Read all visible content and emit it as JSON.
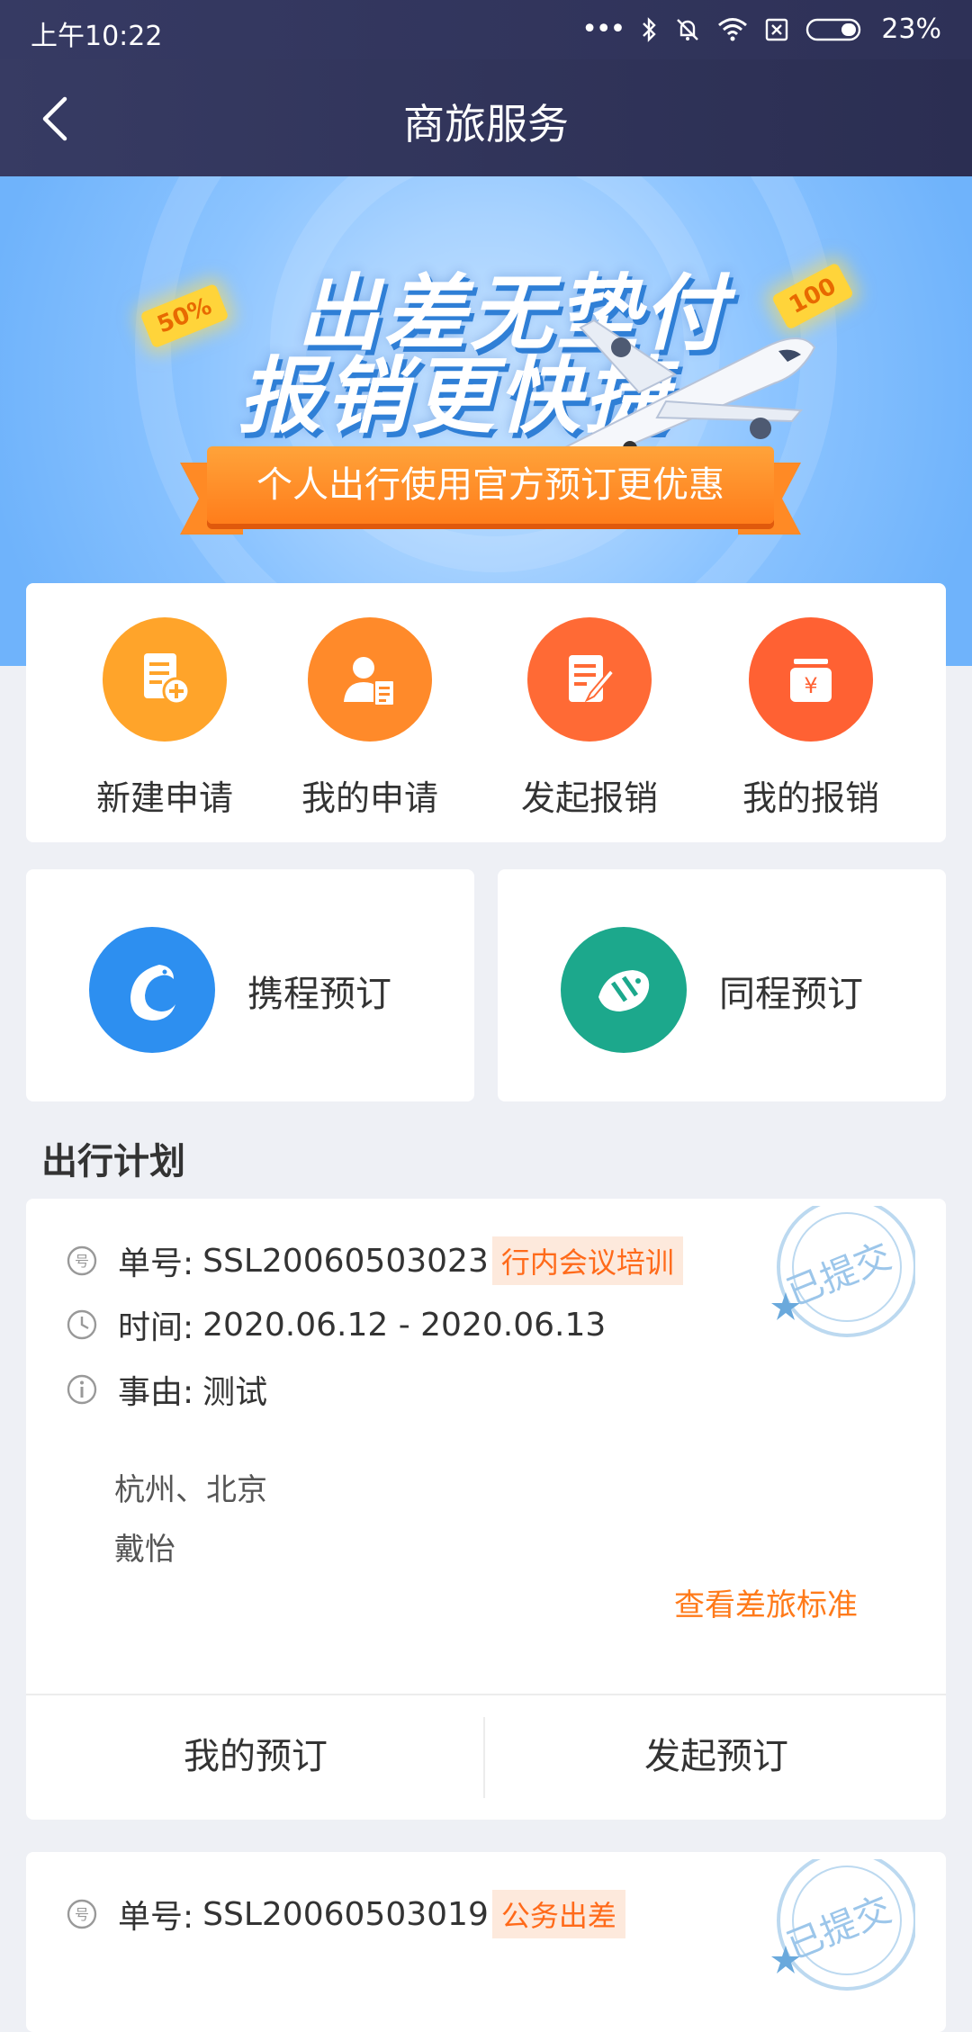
{
  "status_bar": {
    "time": "上午10:22",
    "battery": "23%"
  },
  "nav": {
    "title": "商旅服务"
  },
  "banner": {
    "headline_1": "出差无垫付",
    "headline_2": "报销更快捷",
    "ribbon": "个人出行使用官方预订更优惠",
    "tag_left": "50%",
    "tag_right": "100"
  },
  "quick_actions": [
    {
      "label": "新建申请",
      "icon": "new-application-icon",
      "color": "#ffa42a"
    },
    {
      "label": "我的申请",
      "icon": "my-application-icon",
      "color": "#ff8a2a"
    },
    {
      "label": "发起报销",
      "icon": "start-reimbursement-icon",
      "color": "#ff6a35"
    },
    {
      "label": "我的报销",
      "icon": "my-reimbursement-icon",
      "color": "#ff6133"
    }
  ],
  "booking": [
    {
      "label": "携程预订",
      "icon": "ctrip-dolphin-icon",
      "color": "#2d8ff0"
    },
    {
      "label": "同程预订",
      "icon": "tongcheng-fish-icon",
      "color": "#1ca88c"
    }
  ],
  "section_title": "出行计划",
  "plans": [
    {
      "number_label": "单号:",
      "number": "SSL20060503023",
      "tag": "行内会议培训",
      "time_label": "时间:",
      "time": "2020.06.12 - 2020.06.13",
      "reason_label": "事由:",
      "reason": "测试",
      "cities": "杭州、北京",
      "traveler": "戴怡",
      "standard_link": "查看差旅标准",
      "stamp": "已提交",
      "btn_my_booking": "我的预订",
      "btn_start_booking": "发起预订"
    },
    {
      "number_label": "单号:",
      "number": "SSL20060503019",
      "tag": "公务出差",
      "stamp": "已提交"
    }
  ]
}
